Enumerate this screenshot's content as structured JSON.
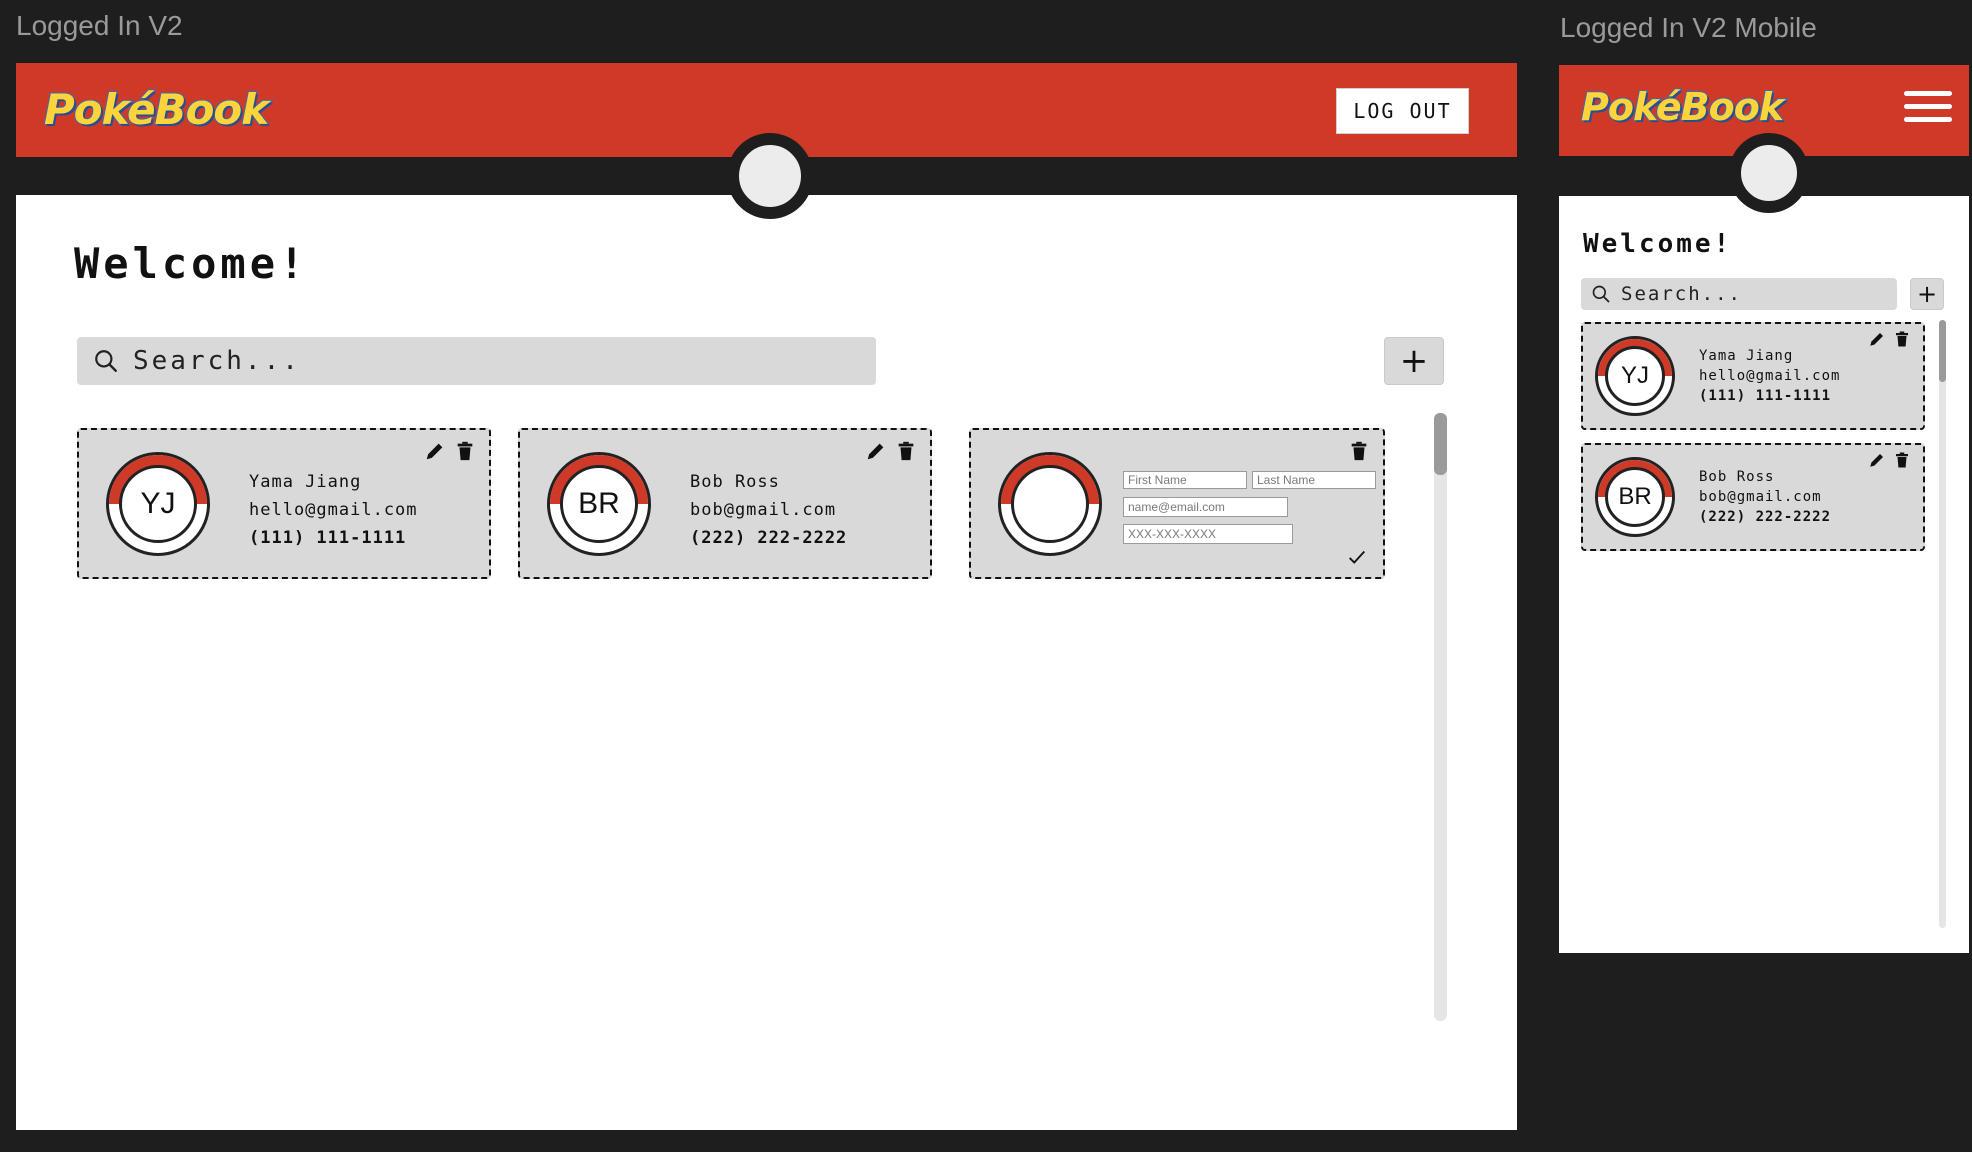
{
  "desktop": {
    "frame_label": "Logged In V2",
    "logo": "PokéBook",
    "logout_label": "LOG OUT",
    "welcome": "Welcome!",
    "search_placeholder": "Search...",
    "add_label": "+",
    "contacts": [
      {
        "initials": "YJ",
        "name": "Yama Jiang",
        "email": "hello@gmail.com",
        "phone": "(111) 111-1111"
      },
      {
        "initials": "BR",
        "name": "Bob Ross",
        "email": "bob@gmail.com",
        "phone": "(222) 222-2222"
      }
    ],
    "new_contact": {
      "first_name_placeholder": "First Name",
      "last_name_placeholder": "Last Name",
      "email_placeholder": "name@email.com",
      "phone_placeholder": "XXX-XXX-XXXX"
    }
  },
  "mobile": {
    "frame_label": "Logged In V2 Mobile",
    "logo": "PokéBook",
    "welcome": "Welcome!",
    "search_placeholder": "Search...",
    "add_label": "+",
    "contacts": [
      {
        "initials": "YJ",
        "name": "Yama Jiang",
        "email": "hello@gmail.com",
        "phone": "(111) 111-1111"
      },
      {
        "initials": "BR",
        "name": "Bob Ross",
        "email": "bob@gmail.com",
        "phone": "(222) 222-2222"
      }
    ]
  },
  "colors": {
    "brand_red": "#cf3a28",
    "dark": "#1e1e1e",
    "card_gray": "#d9d9d9",
    "logo_yellow": "#ffd43b"
  }
}
